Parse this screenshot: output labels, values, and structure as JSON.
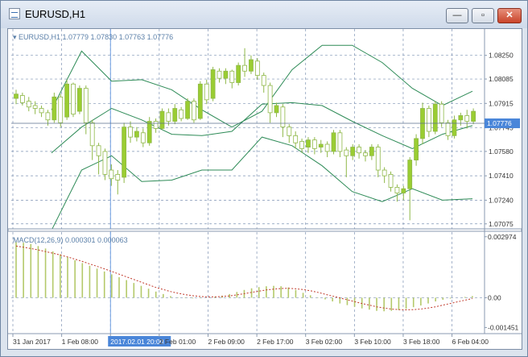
{
  "window": {
    "title": "EURUSD,H1",
    "minimize_glyph": "—",
    "restore_glyph": "▫",
    "close_glyph": "✕"
  },
  "chart_data": [
    {
      "type": "candlestick",
      "title": "EURUSD,H1",
      "header": "▾ EURUSD,H1  1.07779 1.07830 1.07763 1.07776",
      "price_levels": [
        "1.08250",
        "1.08085",
        "1.07915",
        "1.07745",
        "1.07580",
        "1.07410",
        "1.07240",
        "1.07075"
      ],
      "current_price": "1.07776",
      "ylim": [
        1.0704,
        1.084
      ],
      "bands": {
        "upper": [
          1.0787,
          1.0828,
          1.0807,
          1.0808,
          1.0801,
          1.0787,
          1.0775,
          1.0786,
          1.0815,
          1.0832,
          1.0832,
          1.082,
          1.0802,
          1.079,
          1.08
        ],
        "middle": [
          1.0757,
          1.0775,
          1.0788,
          1.078,
          1.077,
          1.0769,
          1.0772,
          1.0791,
          1.0792,
          1.079,
          1.0779,
          1.0769,
          1.076,
          1.077,
          1.0776
        ],
        "lower": [
          1.0703,
          1.0745,
          1.0755,
          1.0737,
          1.0738,
          1.0745,
          1.0745,
          1.0768,
          1.0762,
          1.0748,
          1.073,
          1.0723,
          1.0732,
          1.0724,
          1.0725
        ]
      },
      "candles": [
        [
          1.0795,
          1.0798,
          1.0791,
          1.0801
        ],
        [
          1.0797,
          1.0792,
          1.079,
          1.0799
        ],
        [
          1.0793,
          1.0789,
          1.0786,
          1.0796
        ],
        [
          1.079,
          1.0788,
          1.0784,
          1.0793
        ],
        [
          1.0788,
          1.0785,
          1.0782,
          1.079
        ],
        [
          1.0785,
          1.078,
          1.0776,
          1.0787
        ],
        [
          1.078,
          1.0796,
          1.0778,
          1.0799
        ],
        [
          1.0796,
          1.0778,
          1.0775,
          1.0798
        ],
        [
          1.0782,
          1.0805,
          1.078,
          1.0808
        ],
        [
          1.0805,
          1.0784,
          1.0782,
          1.0806
        ],
        [
          1.0786,
          1.0802,
          1.0784,
          1.0804
        ],
        [
          1.0802,
          1.0778,
          1.077,
          1.0804
        ],
        [
          1.0778,
          1.0762,
          1.0752,
          1.078
        ],
        [
          1.0762,
          1.0755,
          1.0742,
          1.0764
        ],
        [
          1.0758,
          1.0742,
          1.0738,
          1.076
        ],
        [
          1.0745,
          1.0739,
          1.0734,
          1.0749
        ],
        [
          1.0742,
          1.0738,
          1.0728,
          1.0745
        ],
        [
          1.074,
          1.0775,
          1.0736,
          1.0778
        ],
        [
          1.0775,
          1.0768,
          1.0764,
          1.0779
        ],
        [
          1.0768,
          1.0772,
          1.0765,
          1.0775
        ],
        [
          1.0771,
          1.0764,
          1.0761,
          1.0774
        ],
        [
          1.0764,
          1.0779,
          1.0762,
          1.0782
        ],
        [
          1.0779,
          1.0774,
          1.0771,
          1.0781
        ],
        [
          1.0774,
          1.0786,
          1.0773,
          1.0788
        ],
        [
          1.0785,
          1.0779,
          1.0776,
          1.0788
        ],
        [
          1.0779,
          1.0788,
          1.0777,
          1.0791
        ],
        [
          1.0787,
          1.0781,
          1.0779,
          1.0789
        ],
        [
          1.0781,
          1.0793,
          1.078,
          1.0795
        ],
        [
          1.0793,
          1.078,
          1.0778,
          1.0795
        ],
        [
          1.0781,
          1.0805,
          1.078,
          1.0807
        ],
        [
          1.0805,
          1.0794,
          1.0791,
          1.0808
        ],
        [
          1.0795,
          1.0815,
          1.0793,
          1.0817
        ],
        [
          1.0814,
          1.0809,
          1.0806,
          1.0816
        ],
        [
          1.0809,
          1.0814,
          1.0805,
          1.0816
        ],
        [
          1.0814,
          1.0806,
          1.0802,
          1.0815
        ],
        [
          1.0806,
          1.0818,
          1.0804,
          1.082
        ],
        [
          1.0818,
          1.0814,
          1.081,
          1.083
        ],
        [
          1.0814,
          1.0822,
          1.0812,
          1.0825
        ],
        [
          1.0821,
          1.0811,
          1.0808,
          1.0823
        ],
        [
          1.0811,
          1.0804,
          1.0799,
          1.0813
        ],
        [
          1.0804,
          1.0785,
          1.0778,
          1.0806
        ],
        [
          1.0785,
          1.079,
          1.0782,
          1.0792
        ],
        [
          1.0789,
          1.0775,
          1.0768,
          1.0791
        ],
        [
          1.0775,
          1.0769,
          1.0764,
          1.0777
        ],
        [
          1.0769,
          1.0764,
          1.076,
          1.0772
        ],
        [
          1.0765,
          1.076,
          1.0757,
          1.0767
        ],
        [
          1.0761,
          1.0766,
          1.0757,
          1.0768
        ],
        [
          1.0766,
          1.076,
          1.0756,
          1.0768
        ],
        [
          1.0761,
          1.0763,
          1.0757,
          1.0766
        ],
        [
          1.0763,
          1.0758,
          1.0754,
          1.0765
        ],
        [
          1.0758,
          1.0771,
          1.0756,
          1.0773
        ],
        [
          1.0771,
          1.0758,
          1.0754,
          1.0773
        ],
        [
          1.0759,
          1.0755,
          1.074,
          1.0761
        ],
        [
          1.0755,
          1.0761,
          1.0752,
          1.0763
        ],
        [
          1.0761,
          1.0757,
          1.0753,
          1.0763
        ],
        [
          1.0757,
          1.0755,
          1.0751,
          1.0759
        ],
        [
          1.0755,
          1.0761,
          1.0752,
          1.0763
        ],
        [
          1.0761,
          1.0745,
          1.074,
          1.0763
        ],
        [
          1.0745,
          1.0741,
          1.0736,
          1.0747
        ],
        [
          1.0742,
          1.0733,
          1.073,
          1.0744
        ],
        [
          1.0733,
          1.0729,
          1.0723,
          1.0735
        ],
        [
          1.0729,
          1.0732,
          1.0724,
          1.0734
        ],
        [
          1.0732,
          1.0752,
          1.071,
          1.0754
        ],
        [
          1.0752,
          1.0767,
          1.0748,
          1.077
        ],
        [
          1.0767,
          1.0788,
          1.0763,
          1.0792
        ],
        [
          1.0788,
          1.0772,
          1.0768,
          1.079
        ],
        [
          1.0772,
          1.0791,
          1.077,
          1.0793
        ],
        [
          1.0791,
          1.0778,
          1.0775,
          1.0793
        ],
        [
          1.0778,
          1.0769,
          1.0766,
          1.078
        ],
        [
          1.0769,
          1.078,
          1.0767,
          1.0783
        ],
        [
          1.078,
          1.0783,
          1.0776,
          1.0785
        ],
        [
          1.0783,
          1.0779,
          1.0774,
          1.0787
        ],
        [
          1.0779,
          1.0786,
          1.0777,
          1.0788
        ]
      ]
    },
    {
      "type": "bar",
      "title": "MACD(12,26,9)",
      "header": "MACD(12,26,9) 0.000301 0.000063",
      "levels": [
        "0.002974",
        "0.00",
        "-0.001451"
      ],
      "ylim": [
        -0.00175,
        0.0032
      ],
      "values": [
        0.00272,
        0.00268,
        0.00262,
        0.00252,
        0.0024,
        0.00226,
        0.00212,
        0.00198,
        0.00183,
        0.00169,
        0.00156,
        0.00142,
        0.00128,
        0.00114,
        0.001,
        0.00086,
        0.00072,
        0.00058,
        0.00044,
        0.0003,
        0.00018,
        8e-05,
        2e-05,
        -2e-05,
        -3e-05,
        -2e-05,
        0.0,
        4e-05,
        0.0001,
        0.00018,
        0.00028,
        0.00038,
        0.00046,
        0.00052,
        0.00056,
        0.00058,
        0.00056,
        0.0005,
        0.00038,
        0.00024,
        0.00012,
        2e-05,
        -8e-05,
        -0.00018,
        -0.00028,
        -0.00036,
        -0.00044,
        -0.00052,
        -0.00058,
        -0.00064,
        -0.00066,
        -0.00064,
        -0.0006,
        -0.00054,
        -0.00046,
        -0.00038,
        -0.00028,
        -0.00018,
        -0.0001,
        -4e-05,
        0.0,
        4e-05,
        8e-05
      ],
      "signal": [
        0.00252,
        0.00246,
        0.0024,
        0.00233,
        0.00225,
        0.00217,
        0.00208,
        0.00199,
        0.00188,
        0.00177,
        0.00165,
        0.00153,
        0.00141,
        0.00128,
        0.00115,
        0.00102,
        0.00089,
        0.00076,
        0.00063,
        0.0005,
        0.0004,
        0.0003,
        0.00022,
        0.00015,
        0.0001,
        6e-05,
        4e-05,
        4e-05,
        6e-05,
        9e-05,
        0.00014,
        0.0002,
        0.00026,
        0.00032,
        0.00038,
        0.00042,
        0.00045,
        0.00046,
        0.00044,
        0.0004,
        0.00034,
        0.00026,
        0.00017,
        8e-05,
        -1e-05,
        -0.0001,
        -0.00019,
        -0.00028,
        -0.00036,
        -0.00044,
        -0.0005,
        -0.00055,
        -0.00058,
        -0.00059,
        -0.00058,
        -0.00055,
        -0.0005,
        -0.00044,
        -0.00036,
        -0.00028,
        -0.0002,
        -0.00012,
        -4e-05
      ]
    }
  ],
  "time_axis": {
    "labels": [
      "31 Jan 2017",
      "1 Feb 08:00",
      "2017.02.01 20:00",
      "2 Feb 01:00",
      "2 Feb 09:00",
      "2 Feb 17:00",
      "3 Feb 02:00",
      "3 Feb 10:00",
      "3 Feb 18:00",
      "6 Feb 04:00"
    ],
    "highlighted": "2017.02.01 20:00"
  },
  "colors": {
    "bull": "#9acd32",
    "bear": "#ffffff",
    "candle_outline": "#8fb848",
    "band": "#2e8b57",
    "macd_bar": "#b4c96a",
    "signal": "#c0392b",
    "grid": "#7e93b3",
    "price_line": "#5a6f8e",
    "label_bg": "#4a86d9"
  }
}
